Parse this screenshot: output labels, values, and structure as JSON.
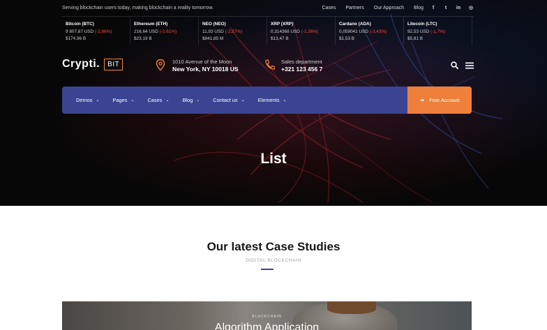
{
  "topbar": {
    "tagline": "Serving blockchain users today, making blockchain a reality tomorrow.",
    "links": [
      "Cases",
      "Partners",
      "Our Approach",
      "Blog"
    ],
    "social": [
      {
        "icon": "facebook-icon",
        "glyph": "f"
      },
      {
        "icon": "twitter-icon",
        "glyph": "t"
      },
      {
        "icon": "linkedin-icon",
        "glyph": "in"
      },
      {
        "icon": "instagram-icon",
        "glyph": "◎"
      }
    ]
  },
  "ticker": [
    {
      "name": "Bitcoin (BTC)",
      "price": "9 807,87 USD",
      "change": "(-2,86%)",
      "cap": "$174,96 B"
    },
    {
      "name": "Ethereum (ETH)",
      "price": "216,64 USD",
      "change": "(-2,61%)",
      "cap": "$23,19 B"
    },
    {
      "name": "NEO (NEO)",
      "price": "11,93 USD",
      "change": "(-2,57%)",
      "cap": "$841,85 M"
    },
    {
      "name": "XRP (XRP)",
      "price": "0,314368 USD",
      "change": "(-1,26%)",
      "cap": "$13,47 B"
    },
    {
      "name": "Cardano (ADA)",
      "price": "0,059041 USD",
      "change": "(-3,43%)",
      "cap": "$1,53 B"
    },
    {
      "name": "Litecoin (LTC)",
      "price": "92,53 USD",
      "change": "(-1,7%)",
      "cap": "$5,81 B"
    }
  ],
  "header": {
    "logo_word": "Crypti.",
    "logo_box": "BIT",
    "address_label": "1010 Avenue of the Moon",
    "address_value": "New York, NY 10018 US",
    "phone_label": "Sales department",
    "phone_value": "+321 123 456 7",
    "icons": [
      "map-pin-icon",
      "phone-icon",
      "search-icon",
      "menu-icon"
    ]
  },
  "nav": {
    "items": [
      "Demos",
      "Pages",
      "Cases",
      "Blog",
      "Contact us",
      "Elements"
    ],
    "cta": "Free Account"
  },
  "hero": {
    "title": "List"
  },
  "section": {
    "title": "Our latest Case Studies",
    "subtitle": "DIGITAL BLOCKCHAIN"
  },
  "card": {
    "category": "BLOCKCHAIN",
    "title": "Algorithm Application"
  },
  "colors": {
    "nav_bg": "#3b4491",
    "accent_orange": "#f07f3c",
    "ticker_negative": "#ff4a3b"
  }
}
